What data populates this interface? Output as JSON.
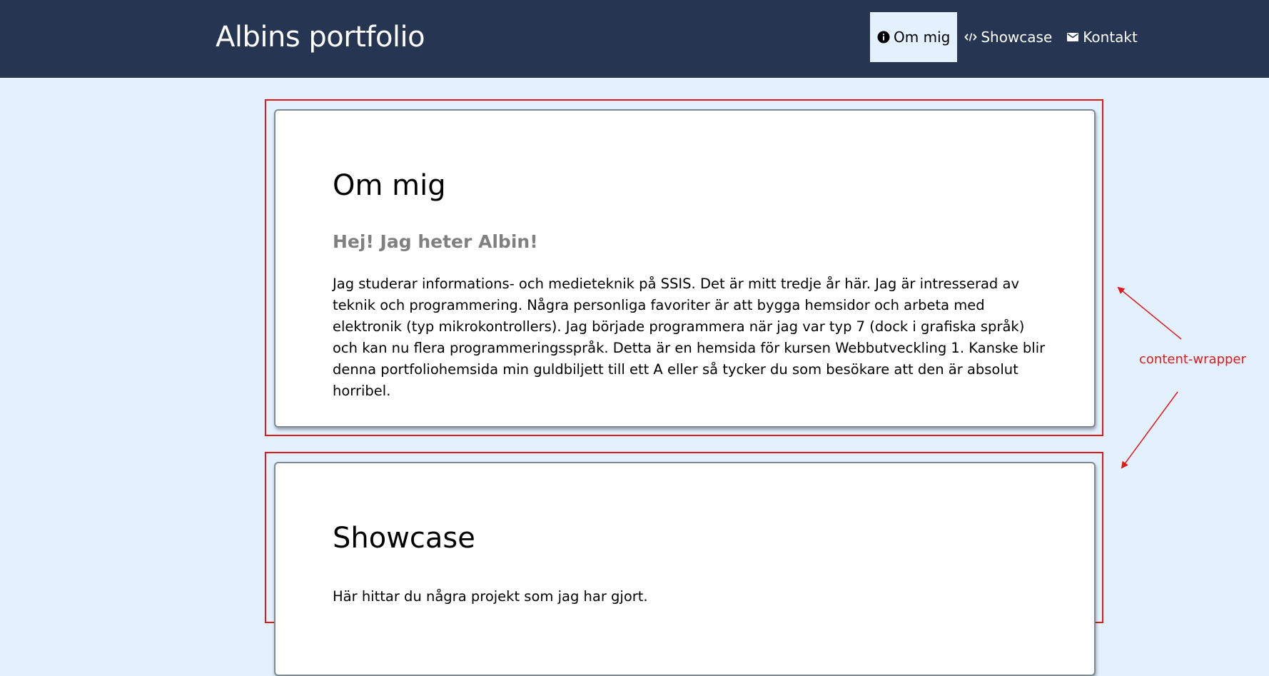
{
  "header": {
    "title": "Albins portfolio",
    "nav": [
      {
        "label": "Om mig",
        "icon": "info-icon",
        "active": true
      },
      {
        "label": "Showcase",
        "icon": "code-icon",
        "active": false
      },
      {
        "label": "Kontakt",
        "icon": "mail-icon",
        "active": false
      }
    ]
  },
  "sections": {
    "about": {
      "heading": "Om mig",
      "subheading": "Hej! Jag heter Albin!",
      "text": "Jag studerar informations- och medieteknik på SSIS. Det är mitt tredje år här. Jag är intresserad av teknik och programmering. Några personliga favoriter är att bygga hemsidor och arbeta med elektronik (typ mikrokontrollers). Jag började programmera när jag var typ 7 (dock i grafiska språk) och kan nu flera programmeringsspråk. Detta är en hemsida för kursen Webbutveckling 1. Kanske blir denna portfoliohemsida min guldbiljett till ett A eller så tycker du som besökare att den är absolut horribel."
    },
    "showcase": {
      "heading": "Showcase",
      "text": "Här hittar du några projekt som jag har gjort."
    }
  },
  "annotation": {
    "label": "content-wrapper"
  },
  "colors": {
    "header_bg": "#253552",
    "page_bg": "#e2f1fd",
    "annotation": "#e31919",
    "subheading": "#808080"
  }
}
